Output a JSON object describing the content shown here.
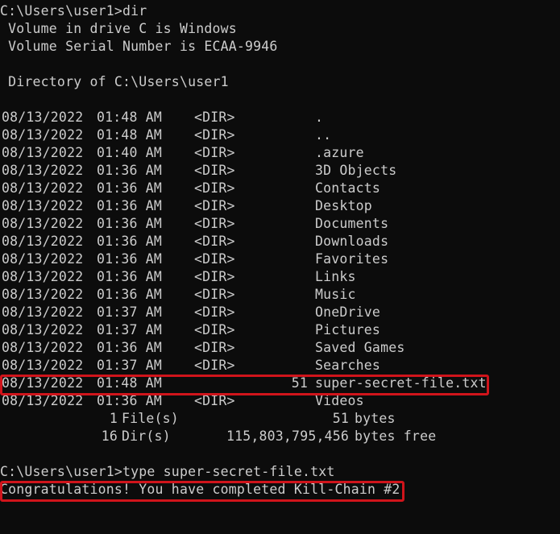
{
  "terminal": {
    "prompt1": "C:\\Users\\user1>dir",
    "volume_line": " Volume in drive C is Windows",
    "serial_line": " Volume Serial Number is ECAA-9946",
    "directory_line": " Directory of C:\\Users\\user1",
    "entries": [
      {
        "date": "08/13/2022",
        "time": "01:48 AM",
        "type": "<DIR>",
        "size": "",
        "name": "."
      },
      {
        "date": "08/13/2022",
        "time": "01:48 AM",
        "type": "<DIR>",
        "size": "",
        "name": ".."
      },
      {
        "date": "08/13/2022",
        "time": "01:40 AM",
        "type": "<DIR>",
        "size": "",
        "name": ".azure"
      },
      {
        "date": "08/13/2022",
        "time": "01:36 AM",
        "type": "<DIR>",
        "size": "",
        "name": "3D Objects"
      },
      {
        "date": "08/13/2022",
        "time": "01:36 AM",
        "type": "<DIR>",
        "size": "",
        "name": "Contacts"
      },
      {
        "date": "08/13/2022",
        "time": "01:36 AM",
        "type": "<DIR>",
        "size": "",
        "name": "Desktop"
      },
      {
        "date": "08/13/2022",
        "time": "01:36 AM",
        "type": "<DIR>",
        "size": "",
        "name": "Documents"
      },
      {
        "date": "08/13/2022",
        "time": "01:36 AM",
        "type": "<DIR>",
        "size": "",
        "name": "Downloads"
      },
      {
        "date": "08/13/2022",
        "time": "01:36 AM",
        "type": "<DIR>",
        "size": "",
        "name": "Favorites"
      },
      {
        "date": "08/13/2022",
        "time": "01:36 AM",
        "type": "<DIR>",
        "size": "",
        "name": "Links"
      },
      {
        "date": "08/13/2022",
        "time": "01:36 AM",
        "type": "<DIR>",
        "size": "",
        "name": "Music"
      },
      {
        "date": "08/13/2022",
        "time": "01:37 AM",
        "type": "<DIR>",
        "size": "",
        "name": "OneDrive"
      },
      {
        "date": "08/13/2022",
        "time": "01:37 AM",
        "type": "<DIR>",
        "size": "",
        "name": "Pictures"
      },
      {
        "date": "08/13/2022",
        "time": "01:36 AM",
        "type": "<DIR>",
        "size": "",
        "name": "Saved Games"
      },
      {
        "date": "08/13/2022",
        "time": "01:37 AM",
        "type": "<DIR>",
        "size": "",
        "name": "Searches"
      },
      {
        "date": "08/13/2022",
        "time": "01:48 AM",
        "type": "",
        "size": "51",
        "name": "super-secret-file.txt"
      },
      {
        "date": "08/13/2022",
        "time": "01:36 AM",
        "type": "<DIR>",
        "size": "",
        "name": "Videos"
      }
    ],
    "summary_files": {
      "count": "1",
      "label": "File(s)",
      "bytes": "51",
      "unit": "bytes"
    },
    "summary_dirs": {
      "count": "16",
      "label": "Dir(s)",
      "bytes": "115,803,795,456",
      "unit": "bytes free"
    },
    "prompt2": "C:\\Users\\user1>type super-secret-file.txt",
    "result": "Congratulations! You have completed Kill-Chain #2"
  },
  "colors": {
    "background": "#0c0c0c",
    "text": "#cccccc",
    "highlight": "#d0141b"
  }
}
